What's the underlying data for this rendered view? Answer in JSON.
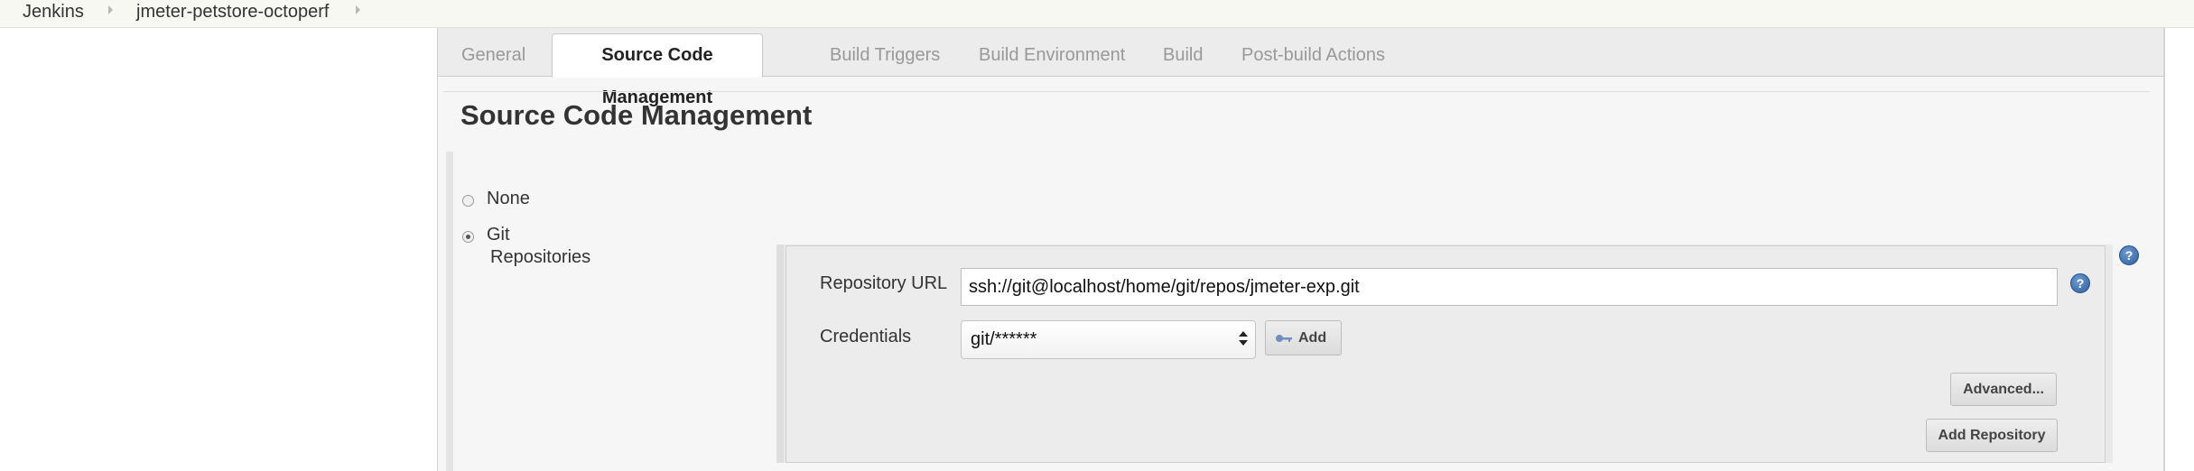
{
  "breadcrumb": {
    "items": [
      {
        "label": "Jenkins"
      },
      {
        "label": "jmeter-petstore-octoperf"
      }
    ]
  },
  "tabs": [
    {
      "label": "General",
      "active": false
    },
    {
      "label": "Source Code Management",
      "active": true
    },
    {
      "label": "Build Triggers",
      "active": false
    },
    {
      "label": "Build Environment",
      "active": false
    },
    {
      "label": "Build",
      "active": false
    },
    {
      "label": "Post-build Actions",
      "active": false
    }
  ],
  "section": {
    "title": "Source Code Management"
  },
  "scm_options": [
    {
      "label": "None",
      "selected": false
    },
    {
      "label": "Git",
      "selected": true
    }
  ],
  "repositories": {
    "label": "Repositories",
    "repository_url": {
      "label": "Repository URL",
      "value": "ssh://git@localhost/home/git/repos/jmeter-exp.git"
    },
    "credentials": {
      "label": "Credentials",
      "selected": "git/******",
      "add_button": "Add"
    },
    "advanced_button": "Advanced...",
    "add_repository_button": "Add Repository"
  },
  "icons": {
    "help": "help-icon",
    "key": "key-icon",
    "breadcrumb_separator": "chevron-right-icon"
  },
  "colors": {
    "help_icon": "#2f5f9e",
    "key_icon": "#6f8fbf"
  }
}
